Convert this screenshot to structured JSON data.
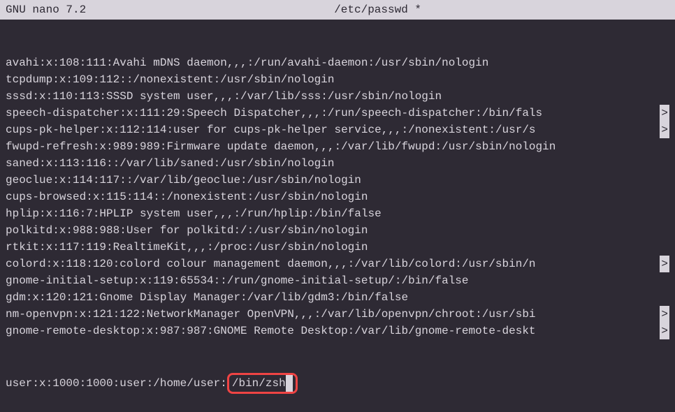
{
  "header": {
    "app": "GNU nano 7.2",
    "filename": "/etc/passwd *"
  },
  "lines": [
    {
      "text": "avahi:x:108:111:Avahi mDNS daemon,,,:/run/avahi-daemon:/usr/sbin/nologin",
      "overflow": false
    },
    {
      "text": "tcpdump:x:109:112::/nonexistent:/usr/sbin/nologin",
      "overflow": false
    },
    {
      "text": "sssd:x:110:113:SSSD system user,,,:/var/lib/sss:/usr/sbin/nologin",
      "overflow": false
    },
    {
      "text": "speech-dispatcher:x:111:29:Speech Dispatcher,,,:/run/speech-dispatcher:/bin/fals",
      "overflow": true
    },
    {
      "text": "cups-pk-helper:x:112:114:user for cups-pk-helper service,,,:/nonexistent:/usr/s",
      "overflow": true
    },
    {
      "text": "fwupd-refresh:x:989:989:Firmware update daemon,,,:/var/lib/fwupd:/usr/sbin/nologin",
      "overflow": false
    },
    {
      "text": "saned:x:113:116::/var/lib/saned:/usr/sbin/nologin",
      "overflow": false
    },
    {
      "text": "geoclue:x:114:117::/var/lib/geoclue:/usr/sbin/nologin",
      "overflow": false
    },
    {
      "text": "cups-browsed:x:115:114::/nonexistent:/usr/sbin/nologin",
      "overflow": false
    },
    {
      "text": "hplip:x:116:7:HPLIP system user,,,:/run/hplip:/bin/false",
      "overflow": false
    },
    {
      "text": "polkitd:x:988:988:User for polkitd:/:/usr/sbin/nologin",
      "overflow": false
    },
    {
      "text": "rtkit:x:117:119:RealtimeKit,,,:/proc:/usr/sbin/nologin",
      "overflow": false
    },
    {
      "text": "colord:x:118:120:colord colour management daemon,,,:/var/lib/colord:/usr/sbin/n",
      "overflow": true
    },
    {
      "text": "gnome-initial-setup:x:119:65534::/run/gnome-initial-setup/:/bin/false",
      "overflow": false
    },
    {
      "text": "gdm:x:120:121:Gnome Display Manager:/var/lib/gdm3:/bin/false",
      "overflow": false
    },
    {
      "text": "nm-openvpn:x:121:122:NetworkManager OpenVPN,,,:/var/lib/openvpn/chroot:/usr/sbi",
      "overflow": true
    },
    {
      "text": "gnome-remote-desktop:x:987:987:GNOME Remote Desktop:/var/lib/gnome-remote-deskt",
      "overflow": true
    }
  ],
  "lastLine": {
    "prefix": "user:x:1000:1000:user:/home/user:",
    "highlight": "/bin/zsh"
  }
}
